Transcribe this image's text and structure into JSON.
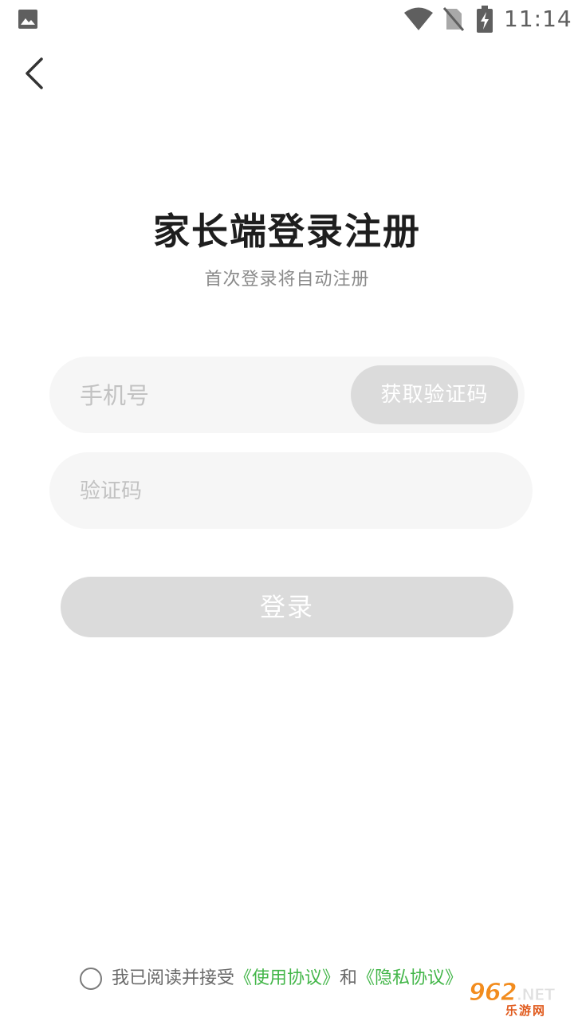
{
  "status_bar": {
    "time": "11:14",
    "icons": [
      "gallery-icon",
      "wifi-icon",
      "no-sim-icon",
      "battery-charging-icon"
    ]
  },
  "header": {
    "back_icon": "chevron-left-icon"
  },
  "title": "家长端登录注册",
  "subtitle": "首次登录将自动注册",
  "form": {
    "phone_placeholder": "手机号",
    "phone_value": "",
    "get_code_label": "获取验证码",
    "code_placeholder": "验证码",
    "code_value": "",
    "login_label": "登录"
  },
  "agreement": {
    "prefix": "我已阅读并接受",
    "terms_link": "《使用协议》",
    "conjunction": "和",
    "privacy_link": "《隐私协议》",
    "checked": false
  },
  "watermark": {
    "main": "962",
    "suffix": ".NET",
    "sub": "乐游网"
  },
  "colors": {
    "link": "#43b649",
    "button_disabled": "#dbdbdb",
    "input_bg": "#f6f6f6",
    "title": "#1e1e1e"
  }
}
